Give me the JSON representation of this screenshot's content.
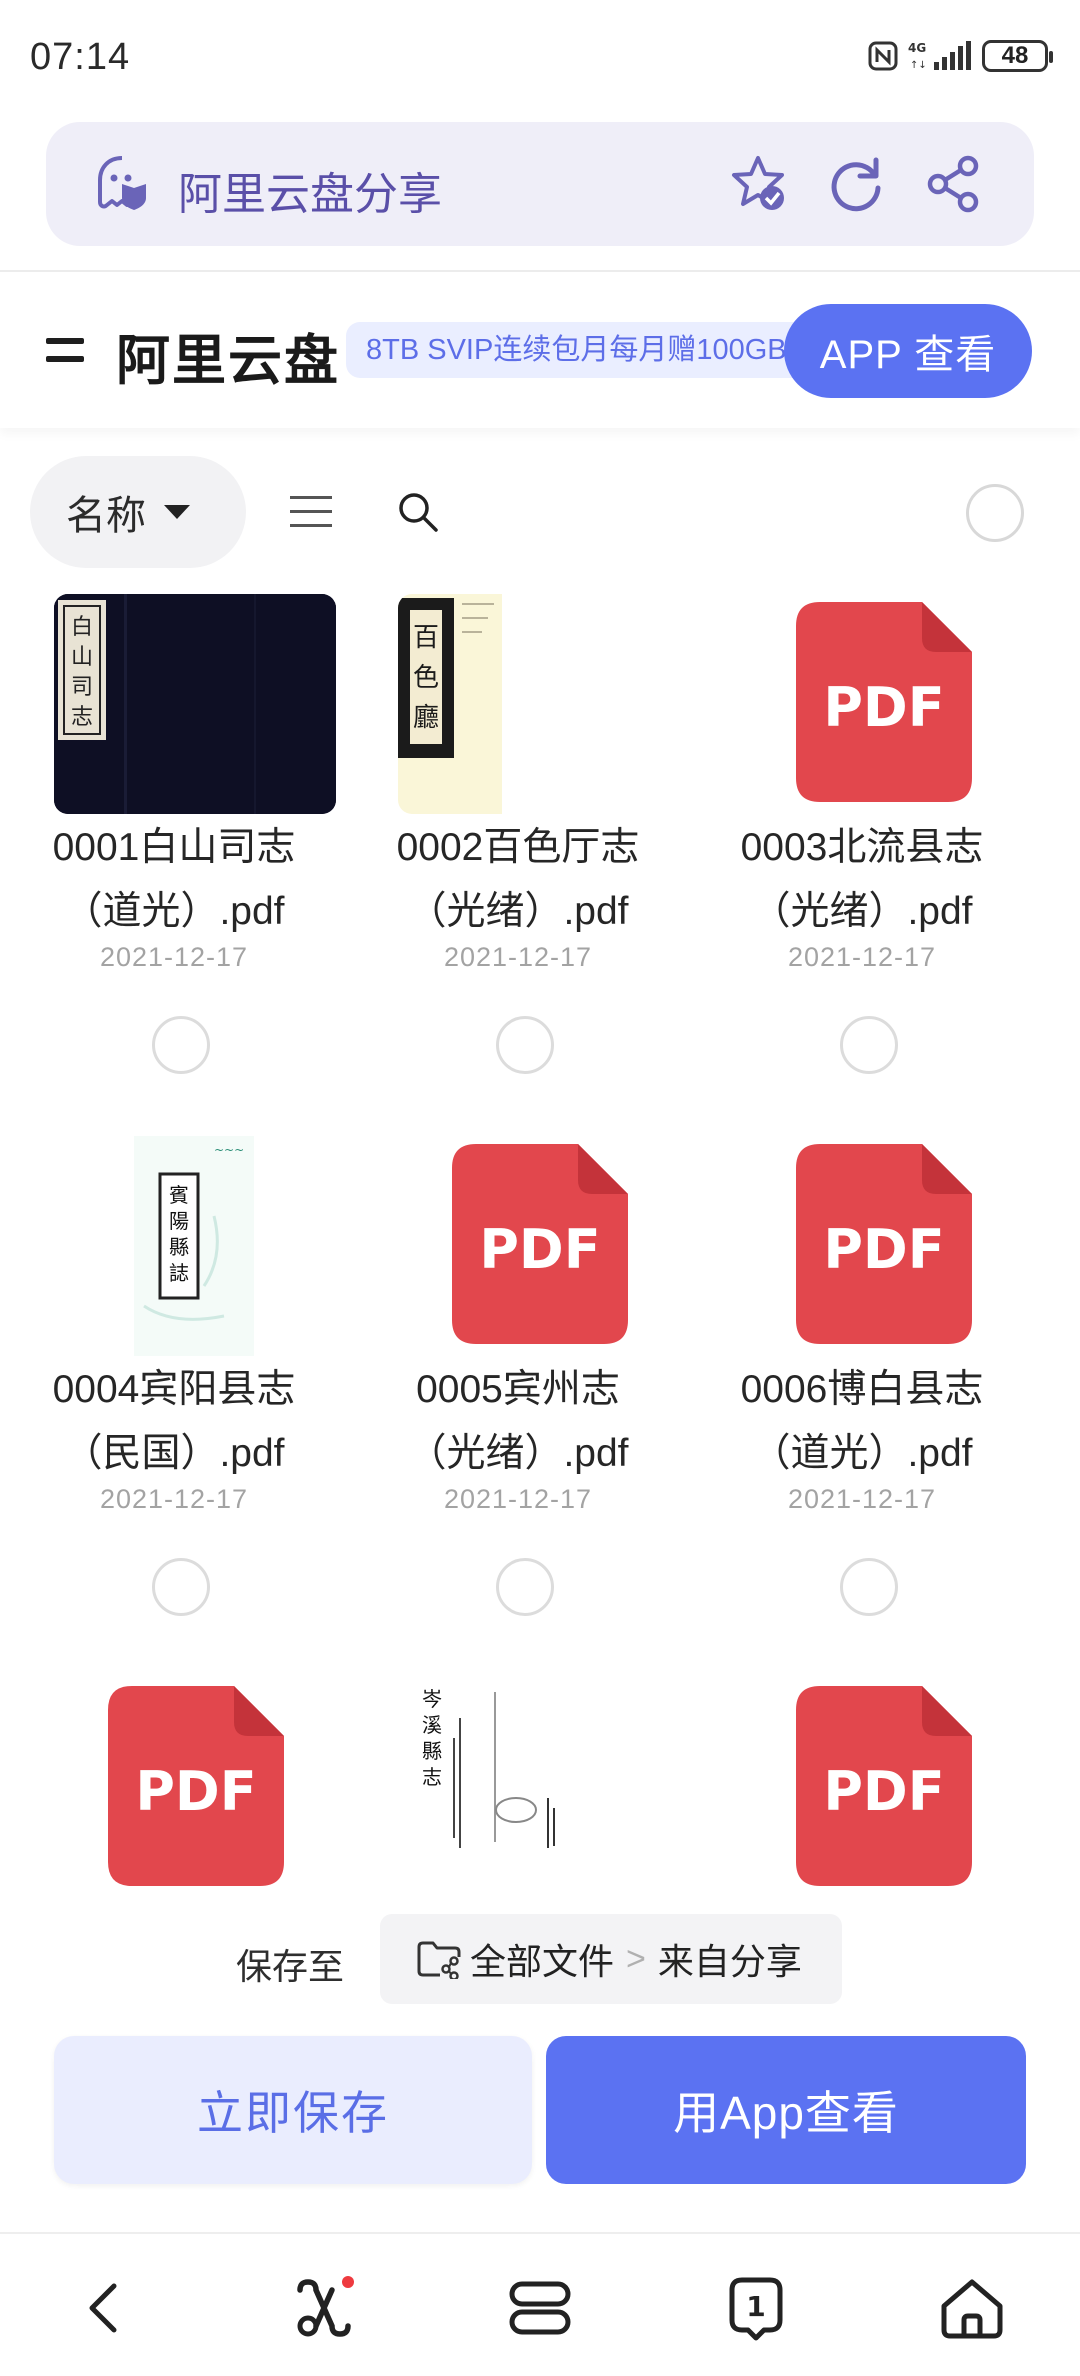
{
  "status_bar": {
    "time": "07:14",
    "network": "4G",
    "battery": "48"
  },
  "browser": {
    "page_title": "阿里云盘分享",
    "icons": [
      "shield-icon",
      "star-check-icon",
      "refresh-icon",
      "share-icon"
    ]
  },
  "header": {
    "title": "阿里云盘",
    "promo": "8TB SVIP连续包月每月赠100GB",
    "app_button": "APP 查看"
  },
  "toolbar": {
    "sort_label": "名称"
  },
  "files": [
    {
      "name_line1": "0001白山司志",
      "name_line2": "（道光）.pdf",
      "date": "2021-12-17",
      "thumb": "scan-dark"
    },
    {
      "name_line1": "0002百色厅志",
      "name_line2": "（光绪）.pdf",
      "date": "2021-12-17",
      "thumb": "scan-light"
    },
    {
      "name_line1": "0003北流县志",
      "name_line2": "（光绪）.pdf",
      "date": "2021-12-17",
      "thumb": "pdf"
    },
    {
      "name_line1": "0004宾阳县志",
      "name_line2": "（民国）.pdf",
      "date": "2021-12-17",
      "thumb": "scan-white"
    },
    {
      "name_line1": "0005宾州志",
      "name_line2": "（光绪）.pdf",
      "date": "2021-12-17",
      "thumb": "pdf"
    },
    {
      "name_line1": "0006博白县志",
      "name_line2": "（道光）.pdf",
      "date": "2021-12-17",
      "thumb": "pdf"
    },
    {
      "thumb": "pdf"
    },
    {
      "thumb": "scan-white"
    },
    {
      "thumb": "pdf"
    }
  ],
  "pdf_label": "PDF",
  "save_bar": {
    "label": "保存至",
    "path_root": "全部文件",
    "path_sep": ">",
    "path_leaf": "来自分享"
  },
  "actions": {
    "save_now": "立即保存",
    "open_app": "用App查看"
  },
  "bottom_nav": {
    "tab_count": "1"
  },
  "colors": {
    "accent": "#5b72f2",
    "pdf_red": "#e2474d",
    "address_bar": "#efeef8"
  }
}
